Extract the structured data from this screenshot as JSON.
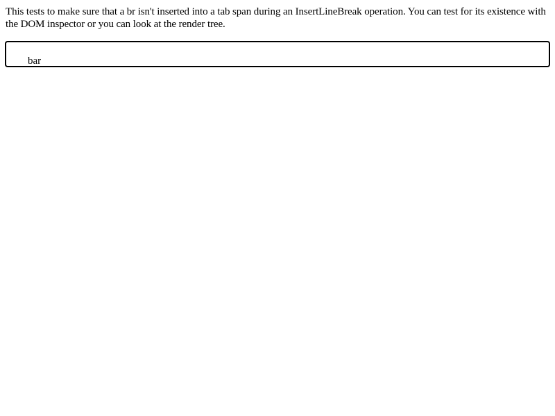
{
  "description": "This tests to make sure that a br isn't inserted into a tab span during an InsertLineBreak operation. You can test for its existence with the DOM inspector or you can look at the render tree.",
  "editor": {
    "text": "bar"
  }
}
